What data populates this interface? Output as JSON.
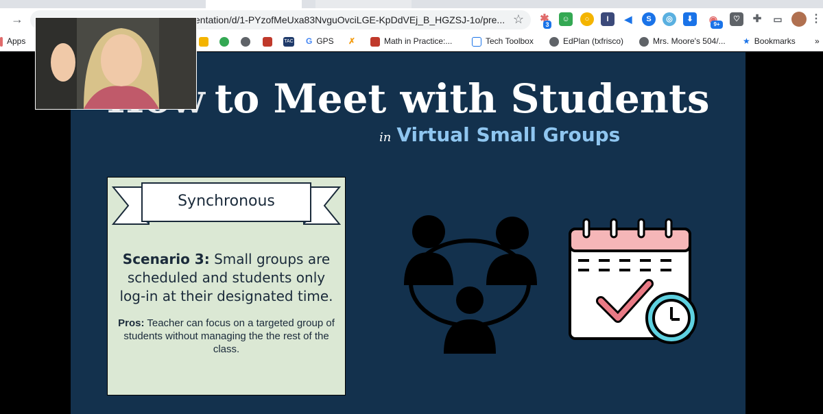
{
  "browser": {
    "url": "entation/d/1-PYzofMeUxa83NvguOvciLGE-KpDdVEj_B_HGZSJ-1o/pre...",
    "ext_badges": {
      "badge_3": "3",
      "badge_9": "9+"
    },
    "bookmarks": {
      "apps": "Apps",
      "tac": "TAC",
      "gps": "GPS",
      "math": "Math in Practice:...",
      "tech": "Tech Toolbox",
      "edplan": "EdPlan (txfrisco)",
      "moore": "Mrs. Moore's 504/...",
      "bookmarks": "Bookmarks",
      "more": "»"
    }
  },
  "slide": {
    "title": "to Meet with Students",
    "subtitle_prefix": "in",
    "subtitle": "Virtual Small Groups",
    "card": {
      "banner": "Synchronous",
      "scenario_label": "Scenario 3:",
      "scenario_text": "Small groups are scheduled and students only log-in at their designated time.",
      "pros_label": "Pros:",
      "pros_text": "Teacher can focus on a targeted group of students without managing the the rest of the class."
    }
  },
  "colors": {
    "slide_bg": "#13314d",
    "card_bg": "#dbe8d4",
    "subtitle": "#8fc6f0",
    "calendar_top": "#f5b6b8",
    "check": "#e97a85",
    "clock_ring": "#5ed1e0"
  },
  "icons": [
    "back-arrow-icon",
    "star-icon",
    "group-people-icon",
    "calendar-check-icon",
    "clock-icon",
    "puzzle-icon",
    "cast-icon",
    "menu-dots-icon"
  ]
}
